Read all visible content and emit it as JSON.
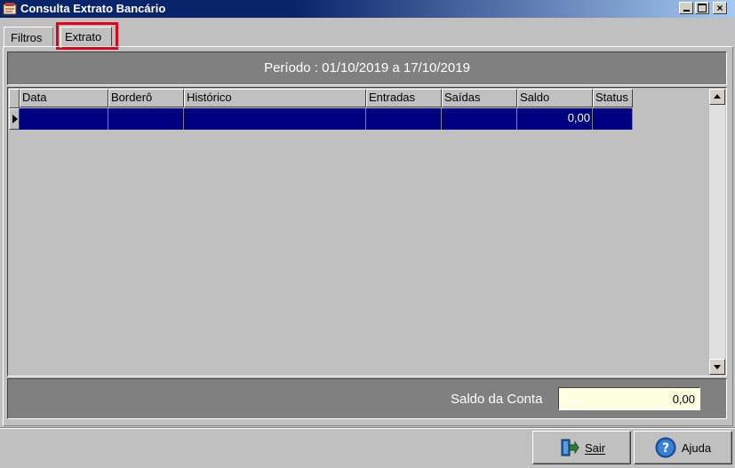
{
  "window": {
    "title": "Consulta Extrato Bancário"
  },
  "tabs": [
    {
      "label": "Filtros",
      "active": false
    },
    {
      "label": "Extrato",
      "active": true
    }
  ],
  "period": {
    "text": "Período : 01/10/2019 a 17/10/2019"
  },
  "grid": {
    "columns": [
      "Data",
      "Borderô",
      "Histórico",
      "Entradas",
      "Saídas",
      "Saldo",
      "Status"
    ],
    "rows": [
      {
        "data": "",
        "bordero": "",
        "historico": "",
        "entradas": "",
        "saidas": "",
        "saldo": "0,00",
        "status": ""
      }
    ]
  },
  "saldo": {
    "label": "Saldo da Conta",
    "value": "0,00"
  },
  "buttons": {
    "sair": "Sair",
    "ajuda": "Ajuda"
  },
  "colors": {
    "title_bar": "#0a246a",
    "selected_row": "#000080",
    "panel_dark": "#808080",
    "saldo_field": "#ffffe1",
    "highlight": "#e3001b"
  }
}
